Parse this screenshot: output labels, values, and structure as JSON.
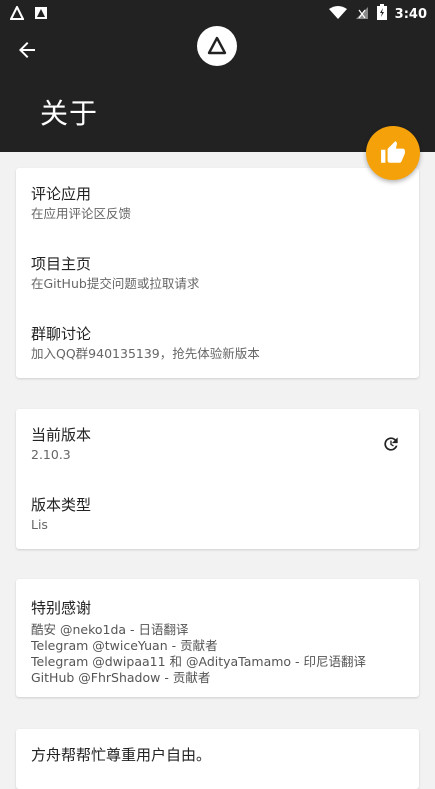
{
  "status_bar": {
    "time": "3:40"
  },
  "header": {
    "title": "关于"
  },
  "card1": {
    "items": [
      {
        "title": "评论应用",
        "subtitle": "在应用评论区反馈"
      },
      {
        "title": "项目主页",
        "subtitle": "在GitHub提交问题或拉取请求"
      },
      {
        "title": "群聊讨论",
        "subtitle": "加入QQ群940135139，抢先体验新版本"
      }
    ]
  },
  "card2": {
    "items": [
      {
        "title": "当前版本",
        "subtitle": "2.10.3"
      },
      {
        "title": "版本类型",
        "subtitle": "Lis"
      }
    ]
  },
  "card3": {
    "title": "特别感谢",
    "lines": [
      "酷安 @neko1da - 日语翻译",
      "Telegram @twiceYuan - 贡献者",
      "Telegram @dwipaa11 和 @AdityaTamamo - 印尼语翻译",
      "GitHub @FhrShadow - 贡献者"
    ]
  },
  "card4": {
    "text": "方舟帮帮忙尊重用户自由。"
  },
  "colors": {
    "header_bg": "#222222",
    "fab": "#f5a10a",
    "page_bg": "#f2f2f2"
  },
  "icons": [
    "back-arrow-icon",
    "app-logo-icon",
    "thumbs-up-icon",
    "refresh-icon",
    "wifi-icon",
    "signal-icon",
    "battery-icon"
  ]
}
